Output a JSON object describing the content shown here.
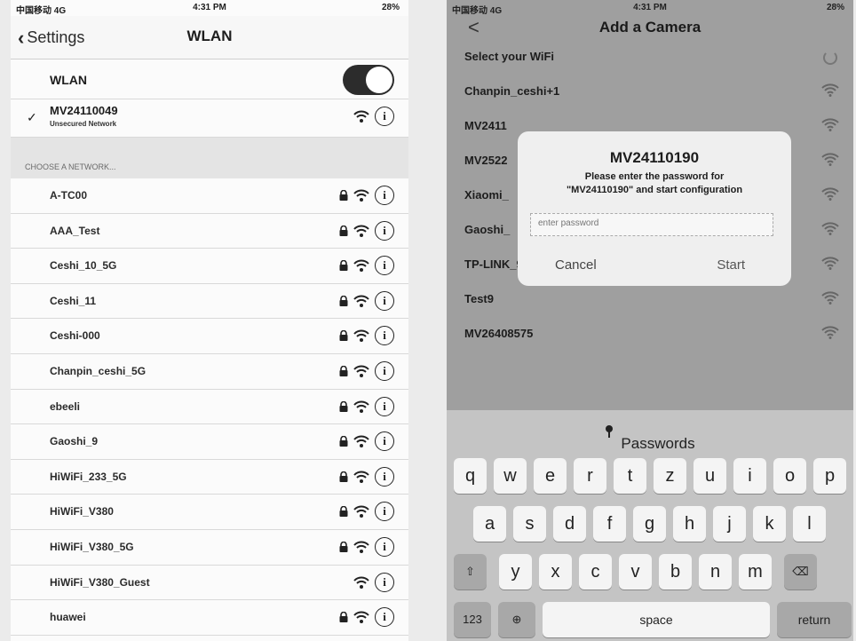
{
  "left": {
    "status": {
      "carrier": "中国移动 4G",
      "time": "4:31 PM",
      "battery": "28%"
    },
    "nav": {
      "back": "Settings",
      "title": "WLAN"
    },
    "wlan_label": "WLAN",
    "connected": {
      "ssid": "MV24110049",
      "subtitle": "Unsecured Network"
    },
    "section_header": "CHOOSE A NETWORK...",
    "networks": [
      {
        "ssid": "A-TC00",
        "locked": true
      },
      {
        "ssid": "AAA_Test",
        "locked": true
      },
      {
        "ssid": "Ceshi_10_5G",
        "locked": true
      },
      {
        "ssid": "Ceshi_11",
        "locked": true
      },
      {
        "ssid": "Ceshi-000",
        "locked": true
      },
      {
        "ssid": "Chanpin_ceshi_5G",
        "locked": true
      },
      {
        "ssid": "ebeeli",
        "locked": true
      },
      {
        "ssid": "Gaoshi_9",
        "locked": true
      },
      {
        "ssid": "HiWiFi_233_5G",
        "locked": true
      },
      {
        "ssid": "HiWiFi_V380",
        "locked": true
      },
      {
        "ssid": "HiWiFi_V380_5G",
        "locked": true
      },
      {
        "ssid": "HiWiFi_V380_Guest",
        "locked": false
      },
      {
        "ssid": "huawei",
        "locked": true
      }
    ]
  },
  "right": {
    "status": {
      "carrier": "中国移动 4G",
      "time": "4:31 PM",
      "battery": "28%"
    },
    "nav": {
      "back": "<",
      "title": "Add a Camera"
    },
    "select_label": "Select your WiFi",
    "wifi_list": [
      "Chanpin_ceshi+1",
      "MV2411",
      "MV2522",
      "Xiaomi_",
      "Gaoshi_",
      "TP-LINK_9939",
      "Test9",
      "MV26408575"
    ],
    "dialog": {
      "title": "MV24110190",
      "message_line1": "Please enter the password for",
      "message_line2": "\"MV24110190\" and start configuration",
      "placeholder": "enter password",
      "cancel": "Cancel",
      "start": "Start"
    },
    "keyboard": {
      "bar_label": "Passwords",
      "row1": [
        "q",
        "w",
        "e",
        "r",
        "t",
        "z",
        "u",
        "i",
        "o",
        "p"
      ],
      "row2": [
        "a",
        "s",
        "d",
        "f",
        "g",
        "h",
        "j",
        "k",
        "l"
      ],
      "row3": [
        "y",
        "x",
        "c",
        "v",
        "b",
        "n",
        "m"
      ],
      "num_label": "123",
      "space_label": "space",
      "return_label": "return"
    }
  }
}
